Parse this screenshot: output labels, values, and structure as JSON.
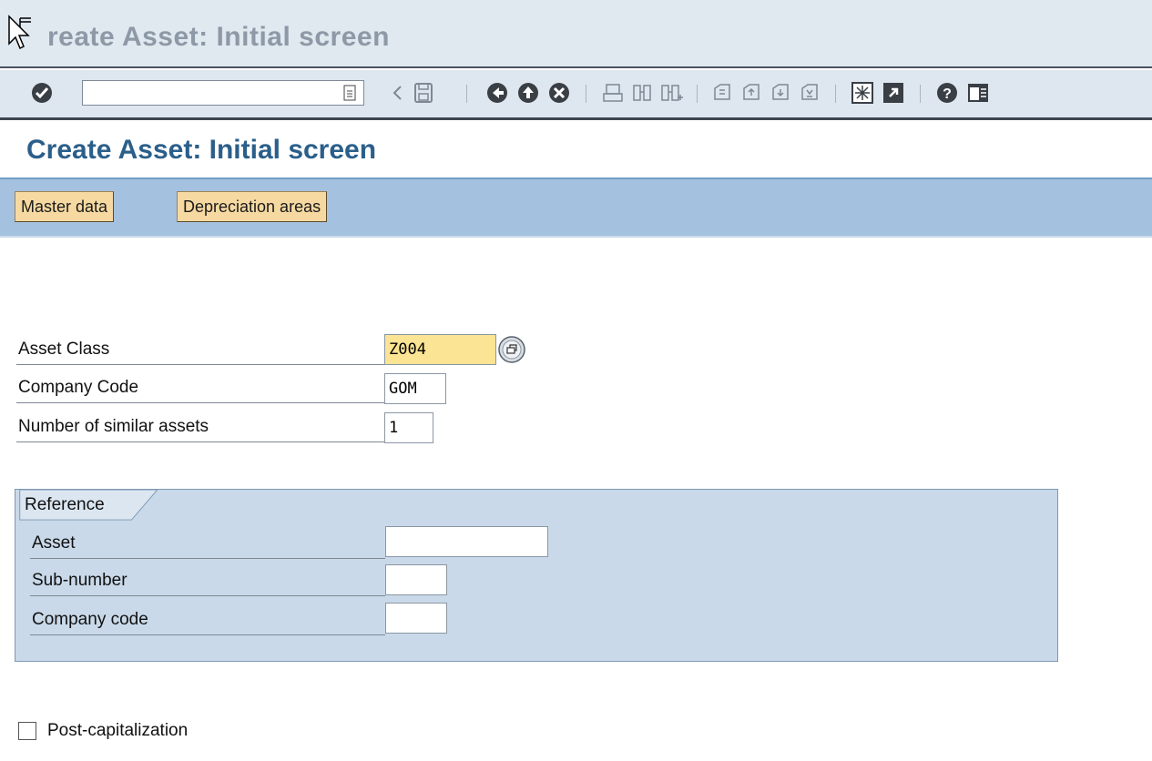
{
  "window": {
    "title": "reate Asset:  Initial screen"
  },
  "toolbar": {
    "command_field_value": "",
    "icons": [
      "enter-icon",
      "history-icon",
      "back-arrow-icon",
      "save-icon",
      "back-icon",
      "exit-icon",
      "cancel-icon",
      "print-icon",
      "find-icon",
      "find-next-icon",
      "first-page-icon",
      "previous-page-icon",
      "next-page-icon",
      "last-page-icon",
      "new-session-icon",
      "shortcut-icon",
      "help-icon",
      "layout-menu-icon"
    ]
  },
  "screen": {
    "title": "Create Asset:  Initial screen"
  },
  "app_toolbar": {
    "buttons": [
      {
        "label": "Master data"
      },
      {
        "label": "Depreciation areas"
      }
    ]
  },
  "form": {
    "asset_class": {
      "label": "Asset Class",
      "value": "Z004"
    },
    "company_code": {
      "label": "Company Code",
      "value": "GOM"
    },
    "similar_assets": {
      "label": "Number of similar assets",
      "value": "1"
    }
  },
  "reference": {
    "title": "Reference",
    "asset": {
      "label": "Asset",
      "value": ""
    },
    "sub_number": {
      "label": "Sub-number",
      "value": ""
    },
    "company_code": {
      "label": "Company code",
      "value": ""
    }
  },
  "post_capitalization": {
    "label": "Post-capitalization",
    "checked": false
  },
  "colors": {
    "app_toolbar_bg": "#a5c1e0",
    "button_bg": "#f6d9a1",
    "required_field_bg": "#fbe493",
    "title_color": "#2b5f8a"
  }
}
